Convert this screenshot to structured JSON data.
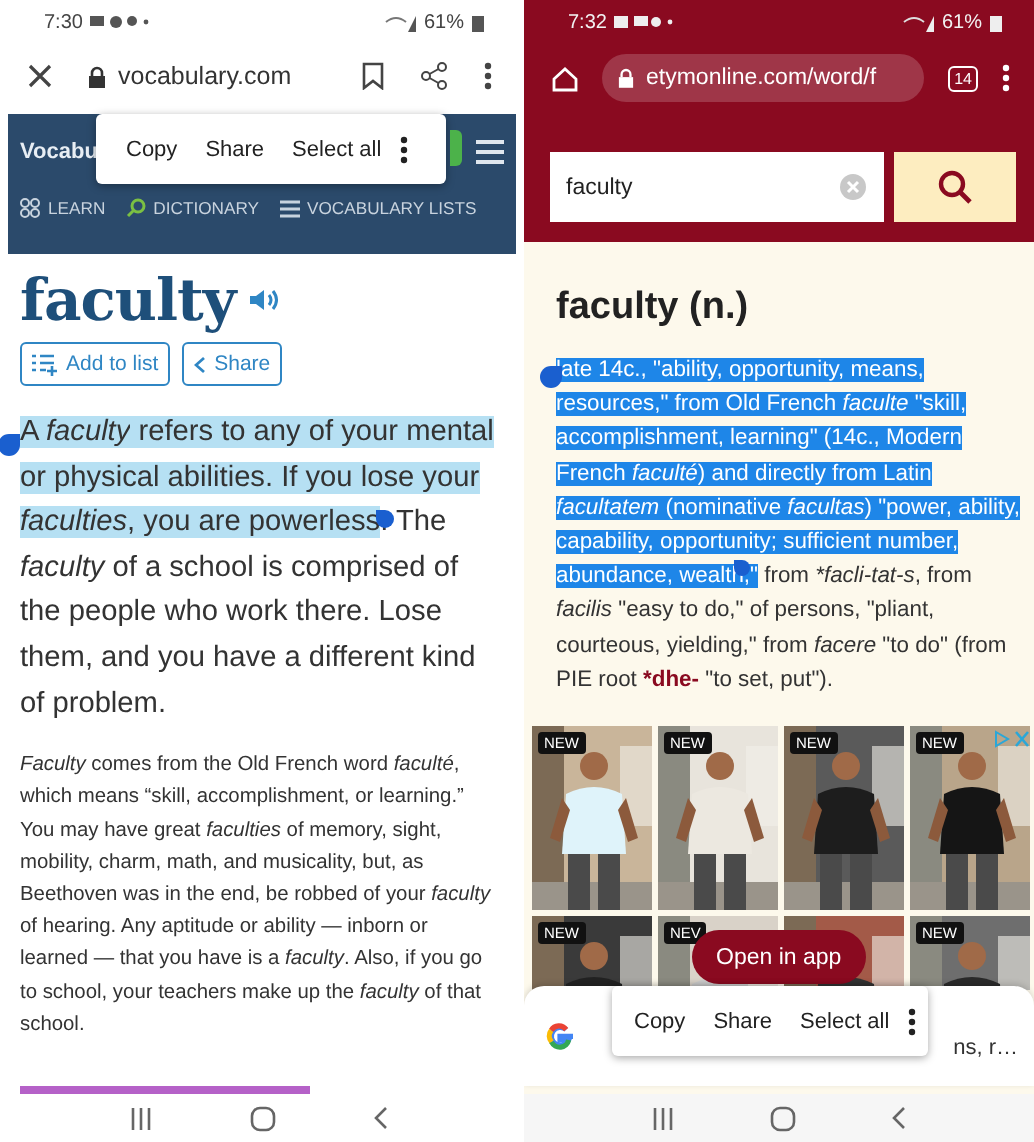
{
  "left_screen": {
    "status_bar": {
      "time": "7:30",
      "battery": "61%"
    },
    "browser": {
      "url": "vocabulary.com"
    },
    "site": {
      "logo": "Vocabu",
      "nav": [
        {
          "label": "LEARN",
          "kind": "grid"
        },
        {
          "label": "DICTIONARY",
          "kind": "search"
        },
        {
          "label": "VOCABULARY LISTS",
          "kind": "list"
        }
      ]
    },
    "popup": {
      "items": [
        "Copy",
        "Share",
        "Select all"
      ]
    },
    "word": "faculty",
    "actions": [
      {
        "label": "Add to list",
        "kind": "add"
      },
      {
        "label": "Share",
        "kind": "share"
      }
    ],
    "short_definition": [
      {
        "text": "A ",
        "kind": "text",
        "highlighted": true
      },
      {
        "text": "faculty",
        "kind": "term",
        "highlighted": true
      },
      {
        "text": " refers to any of your mental or physical abilities. If you lose your ",
        "kind": "text",
        "highlighted": true
      },
      {
        "text": "faculties",
        "kind": "term",
        "highlighted": true
      },
      {
        "text": ", you are powerless",
        "kind": "text",
        "highlighted": true
      },
      {
        "text": ". The ",
        "kind": "text",
        "highlighted": false
      },
      {
        "text": "faculty",
        "kind": "term",
        "highlighted": false
      },
      {
        "text": " of a school is comprised of the people who work there. Lose them, and you have a different kind of problem.",
        "kind": "text",
        "highlighted": false
      }
    ],
    "long_definition": [
      {
        "text": "Faculty",
        "kind": "term",
        "highlighted": false
      },
      {
        "text": " comes from the Old French word ",
        "kind": "text",
        "highlighted": false
      },
      {
        "text": "faculté",
        "kind": "term",
        "highlighted": false
      },
      {
        "text": ", which means “skill, accomplishment, or learning.” You may have great ",
        "kind": "text",
        "highlighted": false
      },
      {
        "text": "faculties",
        "kind": "term",
        "highlighted": false
      },
      {
        "text": " of memory, sight, mobility, charm, math, and musicality, but, as Beethoven was in the end, be robbed of your ",
        "kind": "text",
        "highlighted": false
      },
      {
        "text": "faculty",
        "kind": "term",
        "highlighted": false
      },
      {
        "text": " of hearing. Any aptitude or ability — inborn or learned — that you have is a ",
        "kind": "text",
        "highlighted": false
      },
      {
        "text": "faculty",
        "kind": "term",
        "highlighted": false
      },
      {
        "text": ". Also, if you go to school, your teachers make up the ",
        "kind": "text",
        "highlighted": false
      },
      {
        "text": "faculty",
        "kind": "term",
        "highlighted": false
      },
      {
        "text": " of that school.",
        "kind": "text",
        "highlighted": false
      }
    ]
  },
  "right_screen": {
    "status_bar": {
      "time": "7:32",
      "battery": "61%"
    },
    "browser": {
      "url": "etymonline.com/word/f",
      "tab_count": "14"
    },
    "search": {
      "value": "faculty"
    },
    "entry_title": "faculty (n.)",
    "entry": [
      {
        "text": "late 14c., \"ability, opportunity, means, resources,\" from Old French ",
        "kind": "text",
        "highlighted": true
      },
      {
        "text": "faculte",
        "kind": "term",
        "highlighted": true
      },
      {
        "text": " \"skill, accomplishment, learning\" (14c., Modern French ",
        "kind": "text",
        "highlighted": true
      },
      {
        "text": "faculté",
        "kind": "term",
        "highlighted": true
      },
      {
        "text": ") and directly from Latin ",
        "kind": "text",
        "highlighted": true
      },
      {
        "text": "facultatem",
        "kind": "term",
        "highlighted": true
      },
      {
        "text": " (nominative ",
        "kind": "text",
        "highlighted": true
      },
      {
        "text": "facultas",
        "kind": "term",
        "highlighted": true
      },
      {
        "text": ") \"power, ability, capability, opportunity; sufficient number, abundance, wealth,\"",
        "kind": "text",
        "highlighted": true
      },
      {
        "text": " from ",
        "kind": "text",
        "highlighted": false
      },
      {
        "text": "*facli-tat-s",
        "kind": "term",
        "highlighted": false
      },
      {
        "text": ", from ",
        "kind": "text",
        "highlighted": false
      },
      {
        "text": "facilis",
        "kind": "term",
        "highlighted": false
      },
      {
        "text": " \"easy to do,\" of persons, \"pliant, courteous, yielding,\" from ",
        "kind": "text",
        "highlighted": false
      },
      {
        "text": "facere",
        "kind": "term",
        "highlighted": false
      },
      {
        "text": " \"to do\" (from PIE root ",
        "kind": "text",
        "highlighted": false
      },
      {
        "text": "*dhe-",
        "kind": "root",
        "highlighted": false
      },
      {
        "text": " \"to set, put\").",
        "kind": "text",
        "highlighted": false
      }
    ],
    "ad": {
      "tiles": [
        {
          "kind": "picture",
          "badge": "NEW"
        },
        {
          "kind": "picture",
          "badge": "NEW"
        },
        {
          "kind": "picture",
          "badge": "NEW"
        },
        {
          "kind": "picture",
          "badge": "NEW"
        },
        {
          "kind": "picture",
          "badge": "NEW"
        },
        {
          "kind": "picture",
          "badge": "NEV"
        },
        {
          "kind": "picture"
        },
        {
          "kind": "picture",
          "badge": "NEW"
        }
      ]
    },
    "open_in_app": "Open in app",
    "bottom_sheet": {
      "text": "ns, r…"
    },
    "popup": {
      "items": [
        "Copy",
        "Share",
        "Select all"
      ]
    }
  }
}
